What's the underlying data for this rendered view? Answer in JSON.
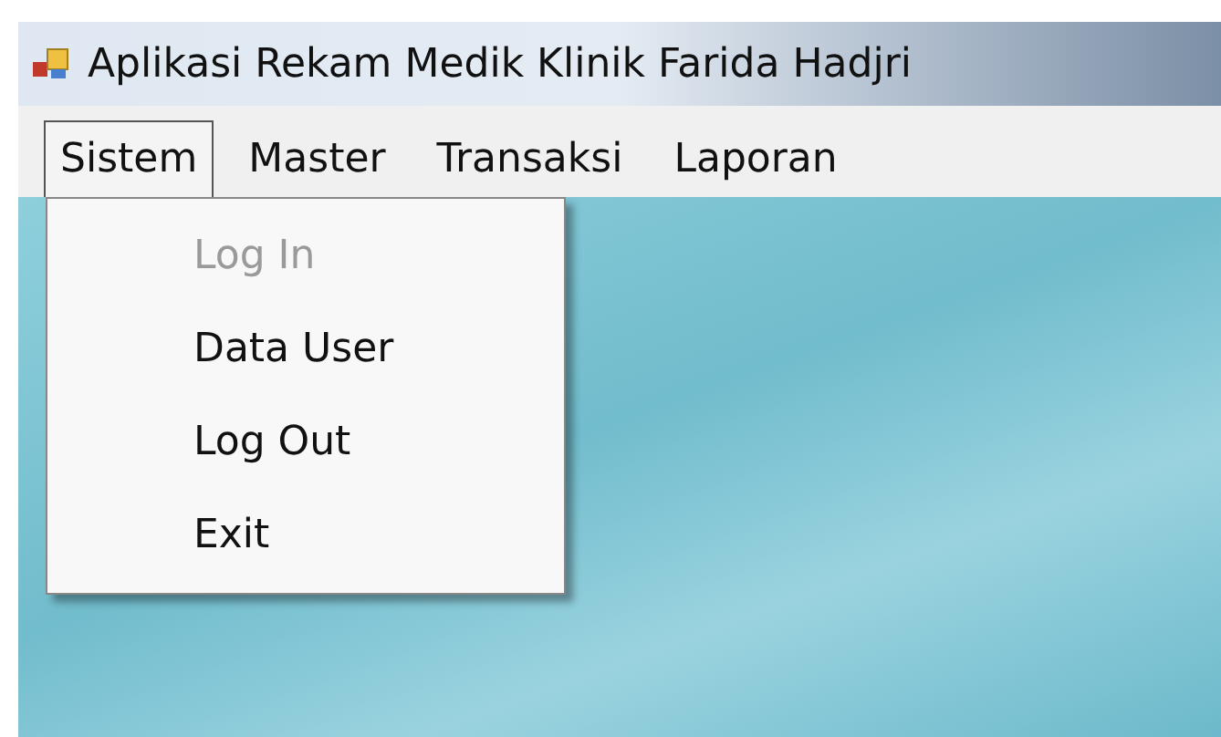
{
  "window": {
    "title": "Aplikasi Rekam Medik Klinik Farida Hadjri"
  },
  "menu_bar": [
    {
      "label": "Sistem",
      "selected": true
    },
    {
      "label": "Master",
      "selected": false
    },
    {
      "label": "Transaksi",
      "selected": false
    },
    {
      "label": "Laporan",
      "selected": false
    }
  ],
  "dropdown": [
    {
      "label": "Log In",
      "disabled": true
    },
    {
      "label": "Data User",
      "disabled": false
    },
    {
      "label": "Log Out",
      "disabled": false
    },
    {
      "label": "Exit",
      "disabled": false
    }
  ]
}
